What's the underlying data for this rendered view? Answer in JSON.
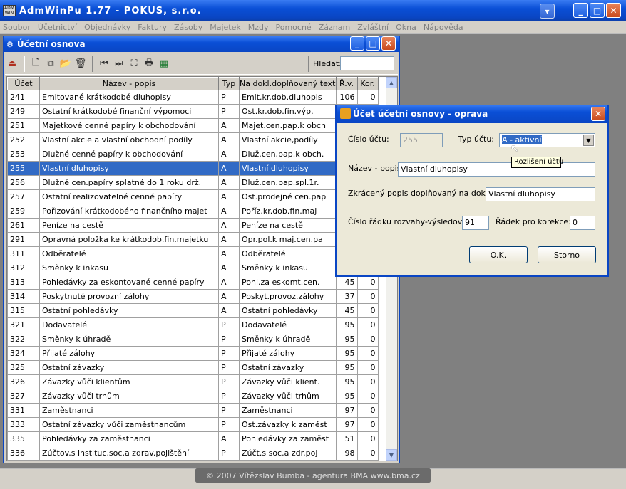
{
  "app": {
    "title": "AdmWinPu 1.77 - POKUS, s.r.o."
  },
  "menu": [
    "Soubor",
    "Účetnictví",
    "Objednávky",
    "Faktury",
    "Zásoby",
    "Majetek",
    "Mzdy",
    "Pomocné",
    "Záznam",
    "Zvláštní",
    "Okna",
    "Nápověda"
  ],
  "child": {
    "title": "Účetní osnova",
    "search_label": "Hledat:",
    "search_value": ""
  },
  "table": {
    "headers": [
      "Účet",
      "Název - popis",
      "Typ",
      "Na dokl.doplňovaný text",
      "Ř.v.",
      "Kor."
    ],
    "selected_index": 5,
    "rows": [
      [
        "241",
        "Emitované krátkodobé dluhopisy",
        "P",
        "Emit.kr.dob.dluhopis",
        "106",
        "0"
      ],
      [
        "249",
        "Ostatní krátkodobé finanční výpomoci",
        "P",
        "Ost.kr.dob.fin.výp.",
        "",
        ""
      ],
      [
        "251",
        "Majetkové cenné papíry k obchodování",
        "A",
        "Majet.cen.pap.k obch",
        "",
        ""
      ],
      [
        "252",
        "Vlastní akcie a vlastní obchodní podíly",
        "A",
        "Vlastní akcie,podíly",
        "",
        ""
      ],
      [
        "253",
        "Dlužné cenné papíry k obchodování",
        "A",
        "Dluž.cen.pap.k obch.",
        "",
        ""
      ],
      [
        "255",
        "Vlastní dluhopisy",
        "A",
        "Vlastní dluhopisy",
        "",
        ""
      ],
      [
        "256",
        "Dlužné cen.papíry splatné do 1 roku drž.",
        "A",
        "Dluž.cen.pap.spl.1r.",
        "",
        ""
      ],
      [
        "257",
        "Ostatní realizovatelné cenné papíry",
        "A",
        "Ost.prodejné cen.pap",
        "",
        ""
      ],
      [
        "259",
        "Pořizování krátkodobého finančního majet",
        "A",
        "Poříz.kr.dob.fin.maj",
        "",
        ""
      ],
      [
        "261",
        "Peníze na cestě",
        "A",
        "Peníze na cestě",
        "",
        ""
      ],
      [
        "291",
        "Opravná položka ke krátkodob.fin.majetku",
        "A",
        "Opr.pol.k maj.cen.pa",
        "",
        ""
      ],
      [
        "311",
        "Odběratelé",
        "A",
        "Odběratelé",
        "",
        ""
      ],
      [
        "312",
        "Směnky k inkasu",
        "A",
        "Směnky k inkasu",
        "",
        ""
      ],
      [
        "313",
        "Pohledávky za eskontované cenné papíry",
        "A",
        "Pohl.za eskomt.cen.",
        "45",
        "0"
      ],
      [
        "314",
        "Poskytnuté provozní zálohy",
        "A",
        "Poskyt.provoz.zálohy",
        "37",
        "0"
      ],
      [
        "315",
        "Ostatní pohledávky",
        "A",
        "Ostatní pohledávky",
        "45",
        "0"
      ],
      [
        "321",
        "Dodavatelé",
        "P",
        "Dodavatelé",
        "95",
        "0"
      ],
      [
        "322",
        "Směnky k úhradě",
        "P",
        "Směnky k úhradě",
        "95",
        "0"
      ],
      [
        "324",
        "Přijaté zálohy",
        "P",
        "Přijaté zálohy",
        "95",
        "0"
      ],
      [
        "325",
        "Ostatní závazky",
        "P",
        "Ostatní závazky",
        "95",
        "0"
      ],
      [
        "326",
        "Závazky vůči klientům",
        "P",
        "Závazky vůči klient.",
        "95",
        "0"
      ],
      [
        "327",
        "Závazky vůči trhům",
        "P",
        "Závazky vůči trhům",
        "95",
        "0"
      ],
      [
        "331",
        "Zaměstnanci",
        "P",
        "Zaměstnanci",
        "97",
        "0"
      ],
      [
        "333",
        "Ostatní závazky vůči zaměstnancům",
        "P",
        "Ost.závazky k zaměst",
        "97",
        "0"
      ],
      [
        "335",
        "Pohledávky za zaměstnanci",
        "A",
        "Pohledávky za zaměst",
        "51",
        "0"
      ],
      [
        "336",
        "Zúčtov.s instituc.soc.a zdrav.pojištění",
        "P",
        "Zúčt.s soc.a zdr.poj",
        "98",
        "0"
      ]
    ]
  },
  "dialog": {
    "title": "Účet účetní osnovy - oprava",
    "cislo_label": "Číslo účtu:",
    "cislo_value": "255",
    "typ_label": "Typ účtu:",
    "typ_value": "A - aktivní",
    "tooltip": "Rozlišení účtu",
    "nazev_label": "Název - popis:",
    "nazev_value": "Vlastní dluhopisy",
    "zkraceny_label": "Zkrácený popis doplňovaný na doklady:",
    "zkraceny_value": "Vlastní dluhopisy",
    "radek_label": "Číslo řádku rozvahy-výsledovky:",
    "radek_value": "91",
    "korekce_label": "Řádek pro korekce:",
    "korekce_value": "0",
    "ok_label": "O.K.",
    "cancel_label": "Storno"
  },
  "status": {
    "copyright": "© 2007 Vítězslav Bumba - agentura BMA   www.bma.cz"
  }
}
